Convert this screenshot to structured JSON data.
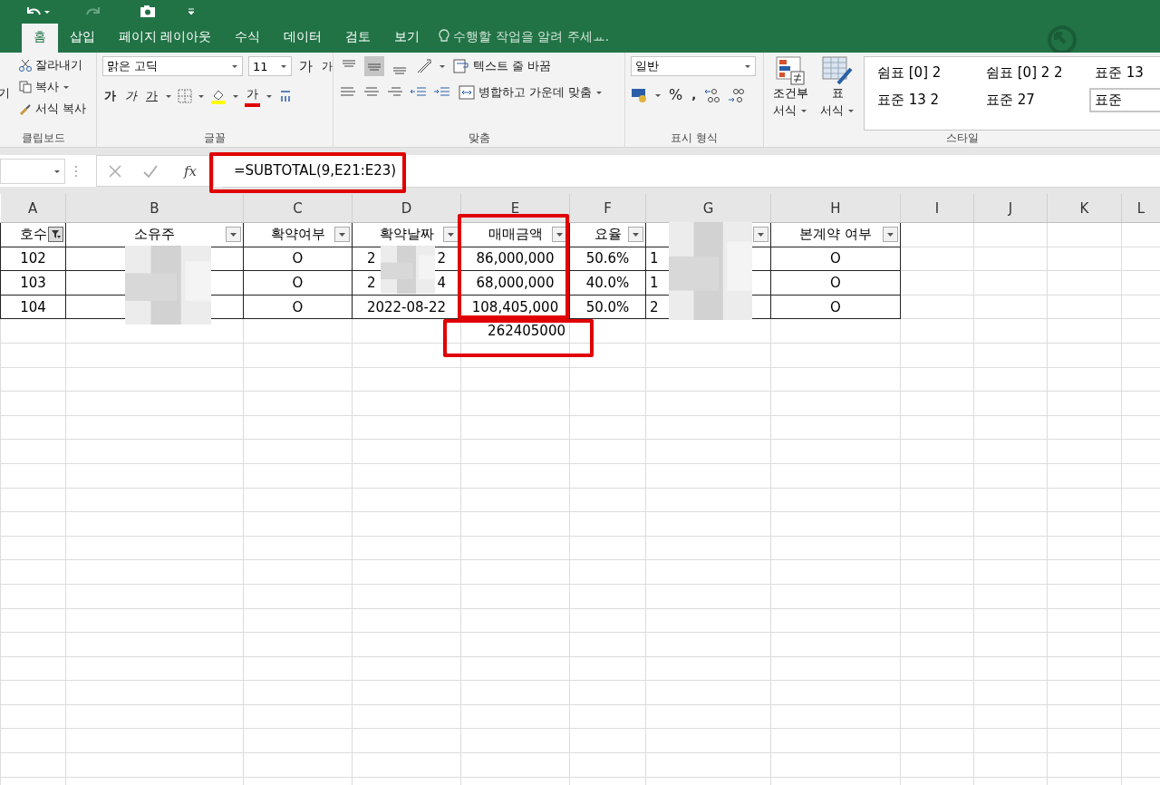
{
  "tabs": [
    {
      "label": "홈",
      "selected": true
    },
    {
      "label": "삽입",
      "selected": false
    },
    {
      "label": "페이지 레이아웃",
      "selected": false
    },
    {
      "label": "수식",
      "selected": false
    },
    {
      "label": "데이터",
      "selected": false
    },
    {
      "label": "검토",
      "selected": false
    },
    {
      "label": "보기",
      "selected": false
    }
  ],
  "tell_me": "수행할 작업을 알려 주세ㅛ.",
  "clipboard": {
    "paste": "기",
    "cut": "잘라내기",
    "copy": "복사",
    "format_painter": "서식 복사",
    "label": "클립보드"
  },
  "font": {
    "name": "맑은 고딕",
    "size": "11",
    "grow": "가",
    "shrink": "가",
    "bold": "가",
    "italic": "가",
    "underline": "가",
    "font_color_label": "가",
    "label": "글꼴"
  },
  "alignment": {
    "vertical": [
      {
        "selected": false
      },
      {
        "selected": true
      },
      {
        "selected": false
      }
    ],
    "wrap": "텍스트 줄 바꿈",
    "merge": "병합하고 가운데 맞춤",
    "label": "맞춤"
  },
  "number": {
    "format": "일반",
    "percent": "%",
    "comma": ",",
    "label": "표시 형식"
  },
  "styles": {
    "conditional": [
      "조건부",
      "서식"
    ],
    "table": [
      "표",
      "서식"
    ],
    "gallery": [
      {
        "label": "쉼표 [0] 2",
        "selected": false
      },
      {
        "label": "쉼표 [0] 2 2",
        "selected": false
      },
      {
        "label": "표준 13",
        "selected": false
      },
      {
        "label": "표준 13 2",
        "selected": false
      },
      {
        "label": "표준 27",
        "selected": false
      },
      {
        "label": "표준",
        "selected": true
      }
    ],
    "label": "스타일"
  },
  "formula_bar": {
    "fx": "fx",
    "formula": "=SUBTOTAL(9,E21:E23)"
  },
  "columns": [
    "A",
    "B",
    "C",
    "D",
    "E",
    "F",
    "G",
    "H",
    "I",
    "J",
    "K",
    "L"
  ],
  "header_row": [
    {
      "text": "호수",
      "filtered": true
    },
    {
      "text": "소유주",
      "filtered": false
    },
    {
      "text": "확약여부",
      "filtered": false
    },
    {
      "text": "확약날짜",
      "filtered": false
    },
    {
      "text": "매매금액",
      "filtered": false
    },
    {
      "text": "요율",
      "filtered": false
    },
    {
      "filtered": false
    },
    {
      "text": "본계약 여부",
      "filtered": false
    }
  ],
  "rows": [
    [
      "102",
      "",
      "O",
      "2",
      "86,000,000",
      "50.6%",
      "1",
      "O"
    ],
    [
      "103",
      "",
      "O",
      "2",
      "68,000,000",
      "40.0%",
      "1",
      "O"
    ],
    [
      "104",
      "",
      "O",
      "2022-08-22",
      "108,405,000",
      "50.0%",
      "2",
      "O"
    ]
  ],
  "date_tails": [
    "2",
    "4"
  ],
  "total": "262405000"
}
